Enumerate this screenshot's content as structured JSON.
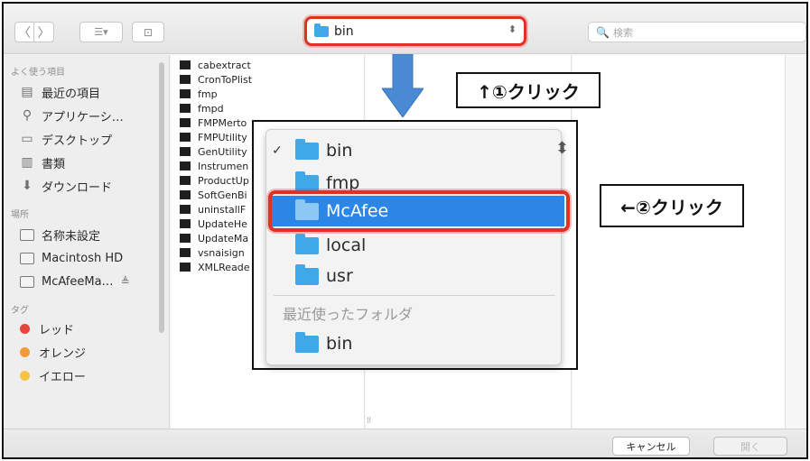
{
  "toolbar": {
    "back_glyph": "〈",
    "forward_glyph": "〉",
    "view_glyph": "☰▾",
    "newfolder_glyph": "⊡",
    "location_label": "bin",
    "location_stepper": "⬍",
    "search_icon": "🔍",
    "search_placeholder": "検索"
  },
  "sidebar": {
    "favorites_header": "よく使う項目",
    "favorites": [
      {
        "label": "最近の項目",
        "icon": "recents-icon"
      },
      {
        "label": "アプリケーシ…",
        "icon": "applications-icon"
      },
      {
        "label": "デスクトップ",
        "icon": "desktop-icon"
      },
      {
        "label": "書類",
        "icon": "documents-icon"
      },
      {
        "label": "ダウンロード",
        "icon": "downloads-icon"
      }
    ],
    "places_header": "場所",
    "places": [
      {
        "label": "名称未設定"
      },
      {
        "label": "Macintosh HD"
      },
      {
        "label": "McAfeeMa…",
        "eject": "≜"
      }
    ],
    "tags_header": "タグ",
    "tags": [
      {
        "label": "レッド",
        "color": "#e8453c"
      },
      {
        "label": "オレンジ",
        "color": "#f29a38"
      },
      {
        "label": "イエロー",
        "color": "#f4c542"
      }
    ]
  },
  "files": [
    "cabextract",
    "CronToPlist",
    "fmp",
    "fmpd",
    "FMPMerto",
    "FMPUtility",
    "GenUtility",
    "Instrumen",
    "ProductUp",
    "SoftGenBi",
    "uninstallF",
    "UpdateHe",
    "UpdateMa",
    "vsnaisign",
    "XMLReade"
  ],
  "popup": {
    "check_mark": "✓",
    "updown": "⬍",
    "items": [
      {
        "label": "bin",
        "checked": true
      },
      {
        "label": "fmp"
      },
      {
        "label": "McAfee",
        "selected": true
      },
      {
        "label": "local"
      },
      {
        "label": "usr"
      }
    ],
    "recent_header": "最近使ったフォルダ",
    "recent_items": [
      {
        "label": "bin"
      }
    ]
  },
  "annotations": {
    "step1": "↑①クリック",
    "step2": "←②クリック",
    "arrow_color": "#4a8ad4",
    "highlight_color": "#e03127"
  },
  "footer": {
    "cancel_label": "キャンセル",
    "open_label": "開く"
  },
  "misc": {
    "tiny_mark": "ll"
  }
}
